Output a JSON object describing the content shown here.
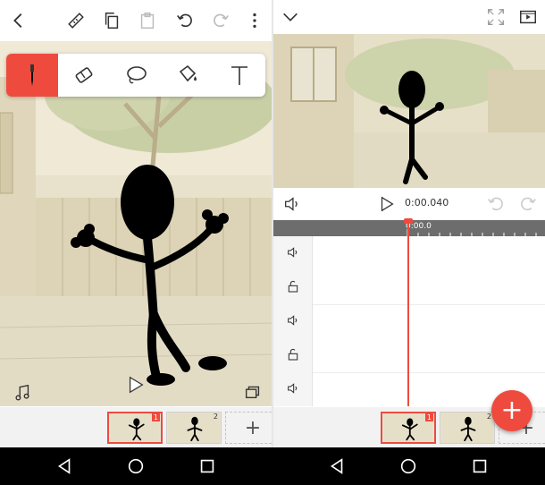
{
  "left_pane": {
    "toolbar": {
      "icons": [
        "back-chevron-icon",
        "ruler-icon",
        "copy-icon",
        "paste-icon",
        "undo-icon",
        "redo-icon",
        "more-vertical-icon"
      ]
    },
    "tools": [
      "pen-icon",
      "eraser-icon",
      "lasso-icon",
      "fill-bucket-icon",
      "text-icon"
    ],
    "active_tool": "pen-icon",
    "frames": [
      {
        "number": "1",
        "selected": true
      },
      {
        "number": "2",
        "selected": false
      }
    ],
    "add_frame_label": "+"
  },
  "right_pane": {
    "timecode": "0:00.040",
    "ruler_label": "0:00.0",
    "fab_label": "+",
    "frames": [
      {
        "number": "1",
        "selected": true
      },
      {
        "number": "2",
        "selected": false
      }
    ],
    "add_frame_label": "+"
  },
  "colors": {
    "accent": "#ee4b3e",
    "ruler": "#6d6d6d"
  }
}
